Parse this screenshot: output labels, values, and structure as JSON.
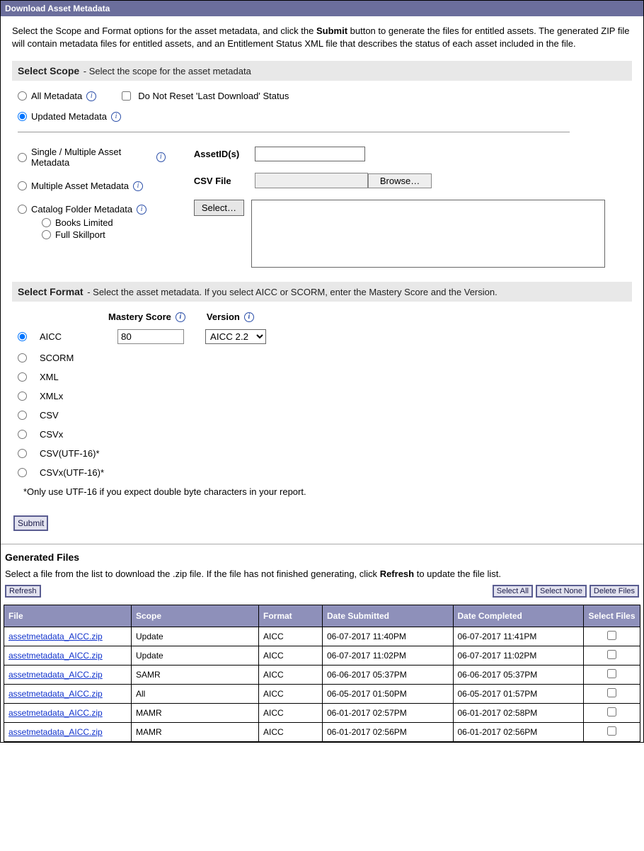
{
  "header": {
    "title": "Download Asset Metadata"
  },
  "intro": {
    "pre": "Select the Scope and Format options for the asset metadata, and click the ",
    "bold": "Submit",
    "post": " button to generate the files for entitled assets. The generated ZIP file will contain metadata files for entitled assets, and an Entitlement Status XML file that describes the status of each asset included in the file."
  },
  "scope": {
    "section_title": "Select Scope",
    "section_desc": " -  Select the scope for the asset metadata",
    "all_metadata": "All Metadata",
    "do_not_reset": "Do Not Reset 'Last Download' Status",
    "updated_metadata": "Updated Metadata",
    "single_multiple": "Single / Multiple Asset Metadata",
    "multiple": "Multiple Asset Metadata",
    "catalog_folder": "Catalog Folder Metadata",
    "books_limited": "Books Limited",
    "full_skillport": "Full Skillport",
    "assetid_label": "AssetID(s)",
    "csv_label": "CSV File",
    "browse_btn": "Browse…",
    "select_btn": "Select…",
    "assetid_value": "",
    "csv_value": ""
  },
  "format": {
    "section_title": "Select Format",
    "section_desc": " -  Select the asset metadata. If you select AICC or SCORM, enter the Mastery Score and the Version.",
    "mastery_label": "Mastery Score",
    "version_label": "Version",
    "mastery_value": "80",
    "version_value": "AICC 2.2",
    "options": [
      "AICC",
      "SCORM",
      "XML",
      "XMLx",
      "CSV",
      "CSVx",
      "CSV(UTF-16)*",
      "CSVx(UTF-16)*"
    ],
    "utf_note": "*Only use UTF-16 if you expect double byte characters in your report."
  },
  "submit_label": "Submit",
  "generated": {
    "title": "Generated Files",
    "desc_pre": "Select a file from the list to download the .zip file. If the file has not finished generating, click ",
    "desc_bold": "Refresh",
    "desc_post": " to update the file list.",
    "refresh_btn": "Refresh",
    "select_all_btn": "Select All",
    "select_none_btn": "Select None",
    "delete_btn": "Delete Files",
    "columns": [
      "File",
      "Scope",
      "Format",
      "Date Submitted",
      "Date Completed",
      "Select Files"
    ],
    "rows": [
      {
        "file": "assetmetadata_AICC.zip",
        "scope": "Update",
        "format": "AICC",
        "submitted": "06-07-2017 11:40PM",
        "completed": "06-07-2017 11:41PM"
      },
      {
        "file": "assetmetadata_AICC.zip",
        "scope": "Update",
        "format": "AICC",
        "submitted": "06-07-2017 11:02PM",
        "completed": "06-07-2017 11:02PM"
      },
      {
        "file": "assetmetadata_AICC.zip",
        "scope": "SAMR",
        "format": "AICC",
        "submitted": "06-06-2017 05:37PM",
        "completed": "06-06-2017 05:37PM"
      },
      {
        "file": "assetmetadata_AICC.zip",
        "scope": "All",
        "format": "AICC",
        "submitted": "06-05-2017 01:50PM",
        "completed": "06-05-2017 01:57PM"
      },
      {
        "file": "assetmetadata_AICC.zip",
        "scope": "MAMR",
        "format": "AICC",
        "submitted": "06-01-2017 02:57PM",
        "completed": "06-01-2017 02:58PM"
      },
      {
        "file": "assetmetadata_AICC.zip",
        "scope": "MAMR",
        "format": "AICC",
        "submitted": "06-01-2017 02:56PM",
        "completed": "06-01-2017 02:56PM"
      }
    ]
  }
}
